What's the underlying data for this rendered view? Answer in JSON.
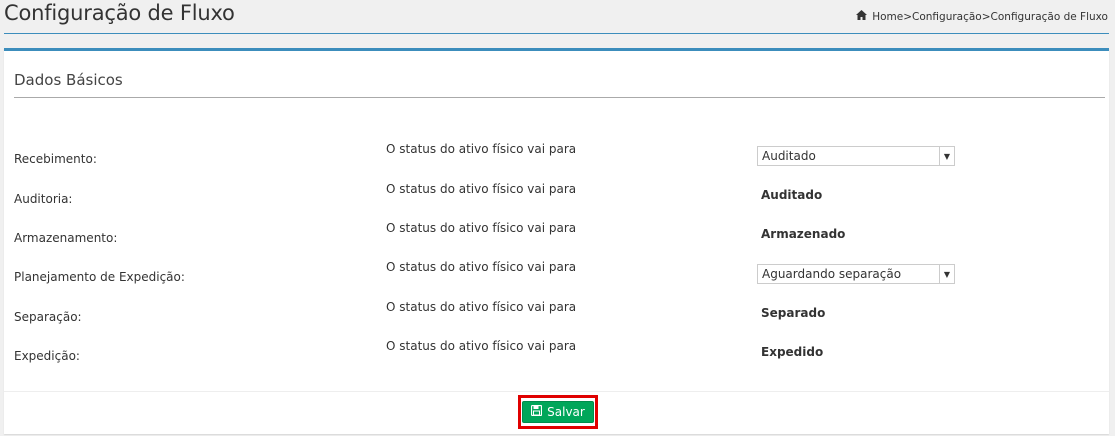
{
  "header": {
    "title": "Configuração de Fluxo",
    "breadcrumb": [
      "Home>",
      "Configuração>",
      "Configuração de Fluxo"
    ]
  },
  "panel": {
    "title": "Dados Básicos",
    "rows": [
      {
        "label": "Recebimento:",
        "desc": "O status do ativo físico vai para",
        "type": "select",
        "value": "Auditado"
      },
      {
        "label": "Auditoria:",
        "desc": "O status do ativo físico vai para",
        "type": "text",
        "value": "Auditado"
      },
      {
        "label": "Armazenamento:",
        "desc": "O status do ativo físico vai para",
        "type": "text",
        "value": "Armazenado"
      },
      {
        "label": "Planejamento de Expedição:",
        "desc": "O status do ativo físico vai para",
        "type": "select",
        "value": "Aguardando separação"
      },
      {
        "label": "Separação:",
        "desc": "O status do ativo físico vai para",
        "type": "text",
        "value": "Separado"
      },
      {
        "label": "Expedição:",
        "desc": "O status do ativo físico vai para",
        "type": "text",
        "value": "Expedido"
      }
    ]
  },
  "footer": {
    "save_label": "Salvar"
  },
  "colors": {
    "accent": "#3c8dbc",
    "save": "#00a65a",
    "highlight": "#e00000"
  }
}
